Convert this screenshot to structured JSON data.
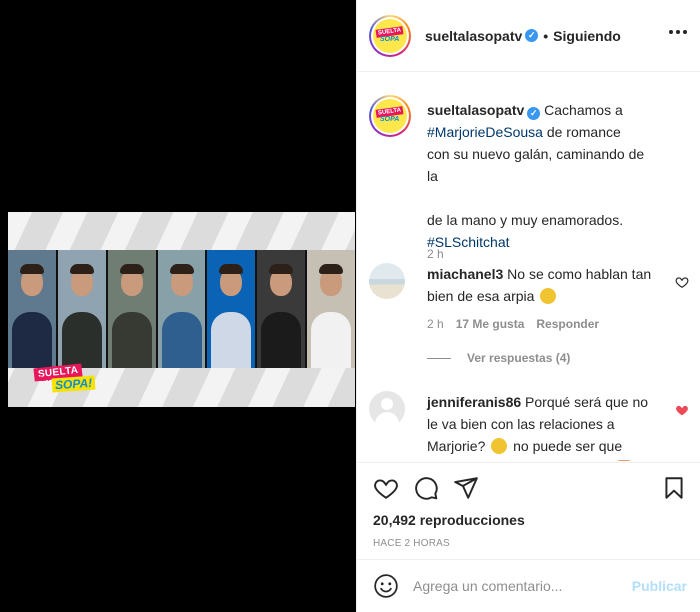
{
  "media": {
    "logo": {
      "line1": "SUELTA",
      "line2": "LA",
      "line3": "SOPA!"
    },
    "person_colors": [
      {
        "shirt": "#1e2a44",
        "bg": "#5f7a8f"
      },
      {
        "shirt": "#2b2f2c",
        "bg": "#8fa3b0"
      },
      {
        "shirt": "#363a33",
        "bg": "#6f7d73"
      },
      {
        "shirt": "#2f5f8f",
        "bg": "#88a0a8"
      },
      {
        "shirt": "#cfd8e6",
        "bg": "#0b63b5"
      },
      {
        "shirt": "#1b1b1b",
        "bg": "#3a3a3a"
      },
      {
        "shirt": "#f1f1f1",
        "bg": "#c6bfb3"
      }
    ]
  },
  "header": {
    "username": "sueltalasopatv",
    "separator": "•",
    "follow_status": "Siguiendo"
  },
  "caption": {
    "username": "sueltalasopatv",
    "text_part1": "Cachamos a",
    "hashtag1": "#MarjorieDeSousa",
    "text_part2": "de romance con su nuevo galán, caminando de la",
    "text_part3": "de la mano y muy enamorados.",
    "hashtag2": "#SLSchitchat",
    "time": "2 h"
  },
  "comments": [
    {
      "username": "miachanel3",
      "text": "No se como hablan tan bien de esa arpia",
      "emoji": "😖",
      "time": "2 h",
      "likes": "17 Me gusta",
      "reply": "Responder",
      "view_replies": "Ver respuestas (4)",
      "liked": false
    },
    {
      "username": "jenniferanis86",
      "text_part1": "Porqué será que no le va bien con las relaciones a Marjorie?",
      "text_part2": "no puede ser que todos los hombre sean malos",
      "liked": true
    }
  ],
  "actions": {
    "views_count": "20,492",
    "views_label": "reproducciones",
    "time_ago": "HACE 2 HORAS"
  },
  "composer": {
    "placeholder": "Agrega un comentario...",
    "post_label": "Publicar"
  },
  "colors": {
    "link": "#00376b",
    "verified": "#3897f0",
    "like_red": "#ed4956",
    "post_disabled": "#b2dffc"
  }
}
